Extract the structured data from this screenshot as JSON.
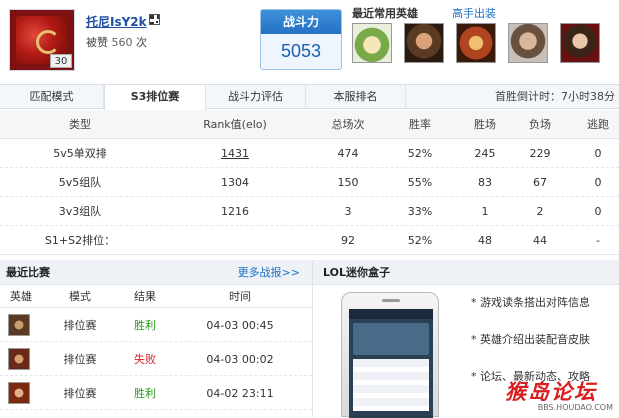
{
  "profile": {
    "name": "托尼IsY2k",
    "level": "30",
    "likes_label": "被赞",
    "likes_count": "560",
    "likes_unit": "次"
  },
  "power": {
    "label": "战斗力",
    "value": "5053"
  },
  "heroes": {
    "title": "最近常用英雄",
    "link": "高手出装",
    "icons": [
      "teemo-portrait",
      "gangplank-portrait",
      "pantheon-portrait",
      "lee-sin-portrait",
      "jarvan-portrait"
    ]
  },
  "tabs": [
    "匹配模式",
    "S3排位赛",
    "战斗力评估",
    "本服排名"
  ],
  "active_tab": "S3排位赛",
  "countdown": "首胜倒计时：7小时38分",
  "stats": {
    "headers": [
      "类型",
      "Rank值(elo)",
      "总场次",
      "胜率",
      "胜场",
      "负场",
      "逃跑"
    ],
    "rows": [
      [
        "5v5单双排",
        "1431",
        "474",
        "52%",
        "245",
        "229",
        "0"
      ],
      [
        "5v5组队",
        "1304",
        "150",
        "55%",
        "83",
        "67",
        "0"
      ],
      [
        "3v3组队",
        "1216",
        "3",
        "33%",
        "1",
        "2",
        "0"
      ],
      [
        "S1+S2排位：",
        "",
        "92",
        "52%",
        "48",
        "44",
        "-"
      ]
    ]
  },
  "recent": {
    "title": "最近比赛",
    "more": "更多战报>>",
    "headers": [
      "英雄",
      "模式",
      "结果",
      "时间"
    ],
    "rows": [
      {
        "mode": "排位赛",
        "result": "胜利",
        "time": "04-03 00:45"
      },
      {
        "mode": "排位赛",
        "result": "失败",
        "time": "04-03 00:02"
      },
      {
        "mode": "排位赛",
        "result": "胜利",
        "time": "04-02 23:11"
      }
    ]
  },
  "mini_box": {
    "title": "LOL迷你盒子",
    "features": [
      "* 游戏读条搭出对阵信息",
      "* 英雄介绍出装配音皮肤",
      "* 论坛、最新动态、攻略"
    ]
  },
  "watermark": {
    "big": "猴岛论坛",
    "small": "BBS.HOUDAO.COM"
  },
  "colors": {
    "win": "#2a9a1a",
    "lose": "#dd2222",
    "link": "#1d6fc9",
    "power": "#2472c4"
  }
}
